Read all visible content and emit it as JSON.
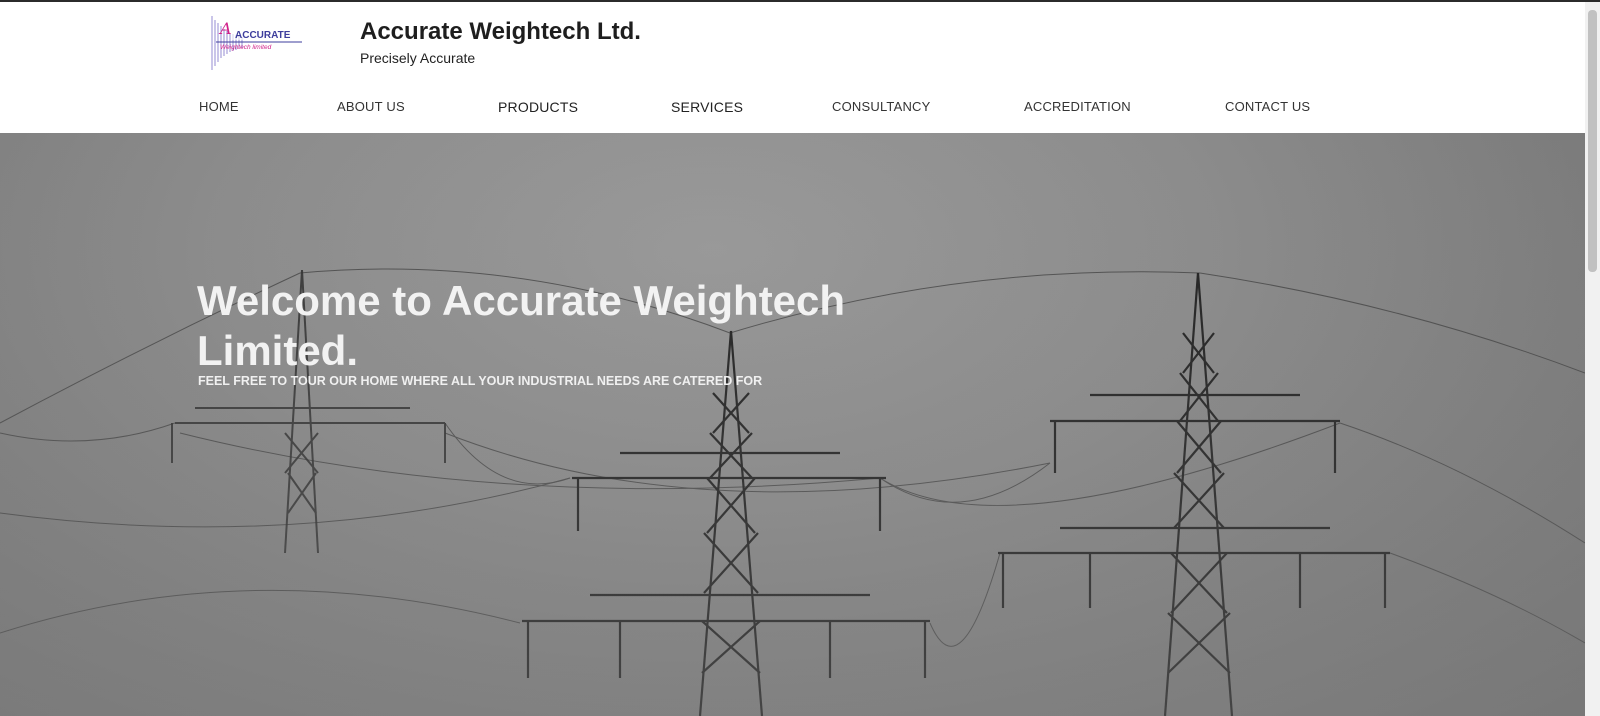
{
  "header": {
    "logo_text": "ACCURATE",
    "logo_subtext": "Weightech limited",
    "title": "Accurate Weightech Ltd.",
    "tagline": "Precisely Accurate"
  },
  "nav": {
    "items": [
      {
        "label": "HOME"
      },
      {
        "label": "ABOUT US"
      },
      {
        "label": "PRODUCTS"
      },
      {
        "label": "SERVICES"
      },
      {
        "label": "CONSULTANCY"
      },
      {
        "label": "ACCREDITATION"
      },
      {
        "label": "CONTACT US"
      }
    ]
  },
  "hero": {
    "heading": "Welcome to Accurate Weightech Limited.",
    "subheading": "FEEL FREE TO TOUR OUR HOME WHERE ALL YOUR INDUSTRIAL NEEDS ARE CATERED FOR",
    "image": "electricity-pylons-in-fog"
  },
  "colors": {
    "accent_logo": "#6b5bb5",
    "logo_magenta": "#d0208a",
    "hero_text": "#f2f2f2"
  }
}
